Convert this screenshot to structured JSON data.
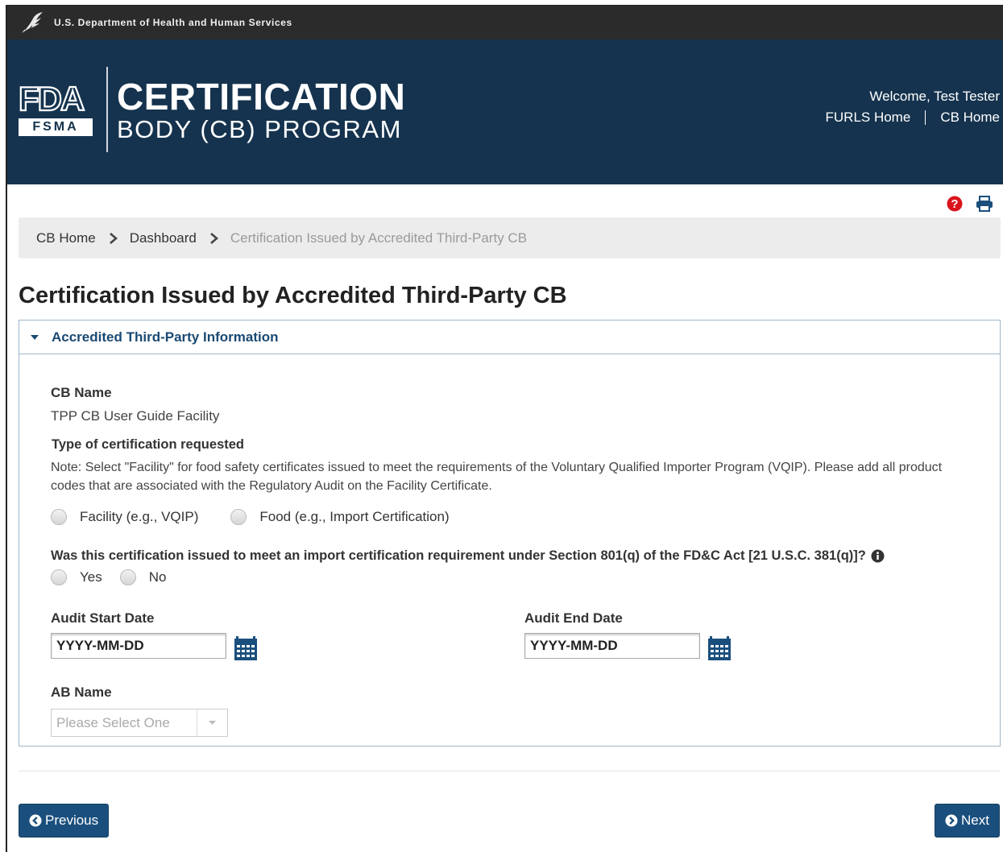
{
  "hhs": {
    "text": "U.S. Department of Health and Human Services"
  },
  "banner": {
    "logo_fda": "FDA",
    "logo_fsma": "FSMA",
    "title_line1": "CERTIFICATION",
    "title_line2": "BODY (CB) PROGRAM",
    "welcome": "Welcome, Test Tester",
    "links": [
      "FURLS Home",
      "CB Home"
    ]
  },
  "tools": {
    "help_icon": "question-circle-icon",
    "print_icon": "print-icon",
    "help_color": "#d9141c",
    "print_color": "#1a4f7d"
  },
  "breadcrumb": [
    "CB Home",
    "Dashboard",
    "Certification Issued by Accredited Third-Party CB"
  ],
  "page": {
    "title": "Certification Issued by Accredited Third-Party CB"
  },
  "panel": {
    "heading": "Accredited Third-Party Information",
    "cb_name_label": "CB Name",
    "cb_name_value": "TPP CB User Guide Facility",
    "cert_type_label": "Type of certification requested",
    "note": "Note: Select \"Facility\" for food safety certificates issued to meet the requirements of the Voluntary Qualified Importer Program (VQIP). Please add all product codes that are associated with the Regulatory Audit on the Facility Certificate.",
    "cert_type_options": [
      "Facility (e.g., VQIP)",
      "Food (e.g., Import Certification)"
    ],
    "question": "Was this certification issued to meet an import certification requirement under Section 801(q) of the FD&C Act [21 U.S.C. 381(q)]?",
    "question_options": [
      "Yes",
      "No"
    ],
    "audit_start_label": "Audit Start Date",
    "audit_start_placeholder": "YYYY-MM-DD",
    "audit_end_label": "Audit End Date",
    "audit_end_placeholder": "YYYY-MM-DD",
    "ab_name_label": "AB Name",
    "ab_name_placeholder": "Please Select One"
  },
  "footer": {
    "previous_label": "Previous",
    "next_label": "Next"
  },
  "colors": {
    "banner": "#15334e",
    "hhs_bar": "#2b2b2b",
    "button": "#1a4f7d",
    "panel_heading": "#1a4a73"
  }
}
